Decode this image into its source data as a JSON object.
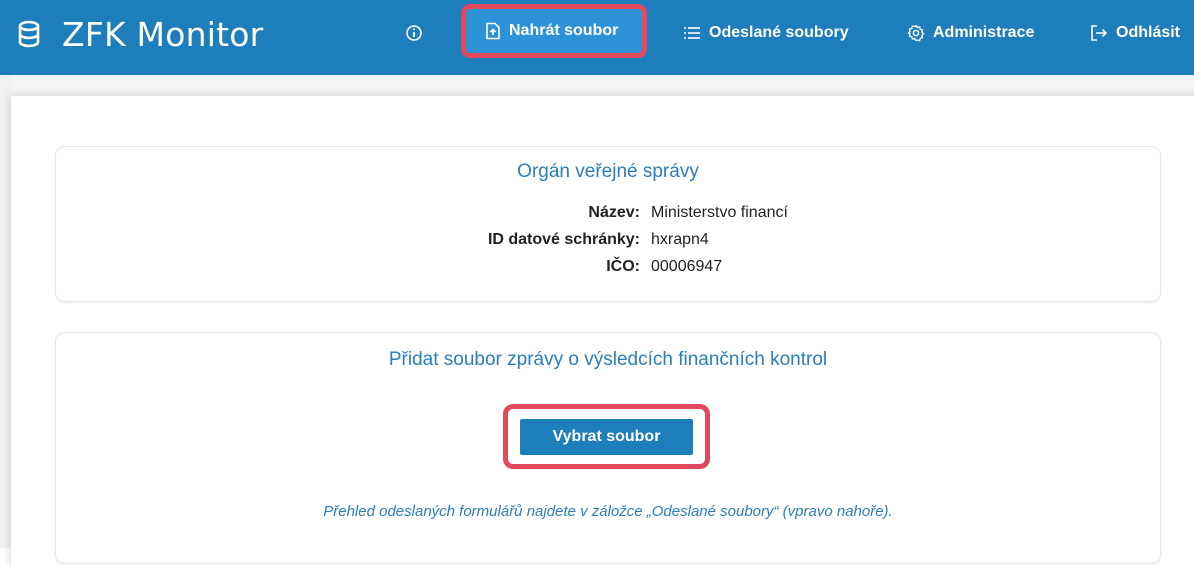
{
  "app": {
    "title": "ZFK Monitor"
  },
  "nav": {
    "info_icon": "info-icon",
    "upload_label": "Nahrát soubor",
    "sent_label": "Odeslané soubory",
    "admin_label": "Administrace",
    "logout_label": "Odhlásit"
  },
  "organ": {
    "heading": "Orgán veřejné správy",
    "rows": [
      {
        "label": "Název:",
        "value": "Ministerstvo financí"
      },
      {
        "label": "ID datové schránky:",
        "value": "hxrapn4"
      },
      {
        "label": "IČO:",
        "value": "00006947"
      }
    ]
  },
  "upload": {
    "heading": "Přidat soubor zprávy o výsledcích finančních kontrol",
    "button_label": "Vybrat soubor",
    "note": "Přehled odeslaných formulářů najdete v záložce „Odeslané soubory“ (vpravo nahoře)."
  },
  "colors": {
    "primary": "#1e7dbb",
    "highlight": "#e14a5c",
    "heading": "#2a7fb8"
  }
}
